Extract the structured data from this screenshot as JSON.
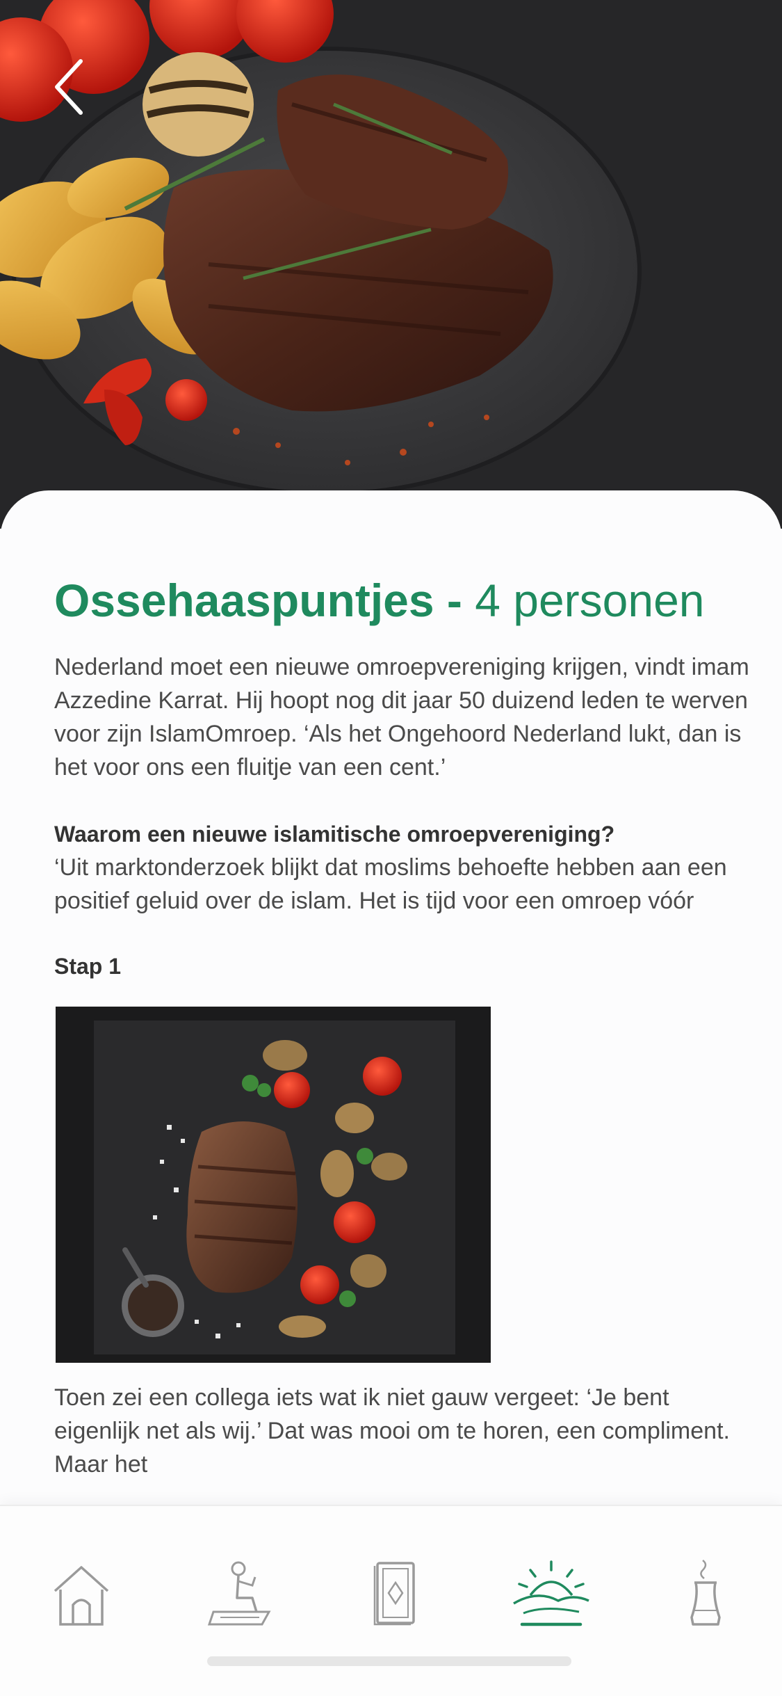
{
  "recipe": {
    "title_main": "Ossehaaspuntjes - ",
    "title_servings": "4 personen"
  },
  "content": {
    "intro": "Nederland moet een nieuwe omroepvereniging krijgen, vindt imam Azzedine Karrat. Hij hoopt nog dit jaar 50 duizend leden te werven voor zijn IslamOmroep. ‘Als het Ongehoord Nederland lukt, dan is het voor ons een fluitje van een cent.’",
    "question_heading": "Waarom een nieuwe islamitische omroepvereniging?",
    "question_body": "‘Uit marktonderzoek blijkt dat moslims behoefte hebben aan een positief geluid over de islam. Het is tijd voor een omroep vóór",
    "step_label": "Stap 1",
    "step_body": "Toen zei een collega iets wat ik niet gauw vergeet: ‘Je bent eigenlijk net als wij.’ Dat was mooi om te horen, een compliment. Maar het"
  },
  "nav": {
    "back_icon": "chevron-left-icon",
    "tabs": [
      {
        "icon": "mosque-icon",
        "active": false
      },
      {
        "icon": "praying-person-icon",
        "active": false
      },
      {
        "icon": "quran-book-icon",
        "active": false
      },
      {
        "icon": "sunrise-icon",
        "active": true
      },
      {
        "icon": "coffee-pot-icon",
        "active": false
      }
    ]
  },
  "colors": {
    "accent": "#1f8a5e",
    "text": "#4a4a4a",
    "tab_inactive": "#9a9a9a"
  }
}
